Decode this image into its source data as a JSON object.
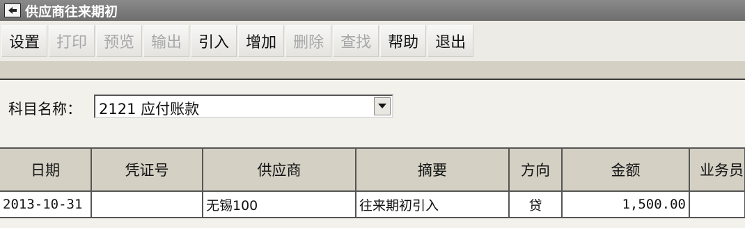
{
  "window": {
    "title": "供应商往来期初"
  },
  "toolbar": {
    "buttons": [
      {
        "label": "设置"
      },
      {
        "label": "打印"
      },
      {
        "label": "预览"
      },
      {
        "label": "输出"
      },
      {
        "label": "引入"
      },
      {
        "label": "增加"
      },
      {
        "label": "删除"
      },
      {
        "label": "查找"
      },
      {
        "label": "帮助"
      },
      {
        "label": "退出"
      }
    ]
  },
  "subject": {
    "label": "科目名称：",
    "value": "2121 应付账款"
  },
  "table": {
    "columns": [
      "日期",
      "凭证号",
      "供应商",
      "摘要",
      "方向",
      "金额",
      "业务员"
    ],
    "rows": [
      {
        "date": "2013-10-31",
        "voucher": "",
        "supplier": "无锡100",
        "summary": "往来期初引入",
        "direction": "贷",
        "amount": "1,500.00",
        "staff": ""
      }
    ]
  }
}
